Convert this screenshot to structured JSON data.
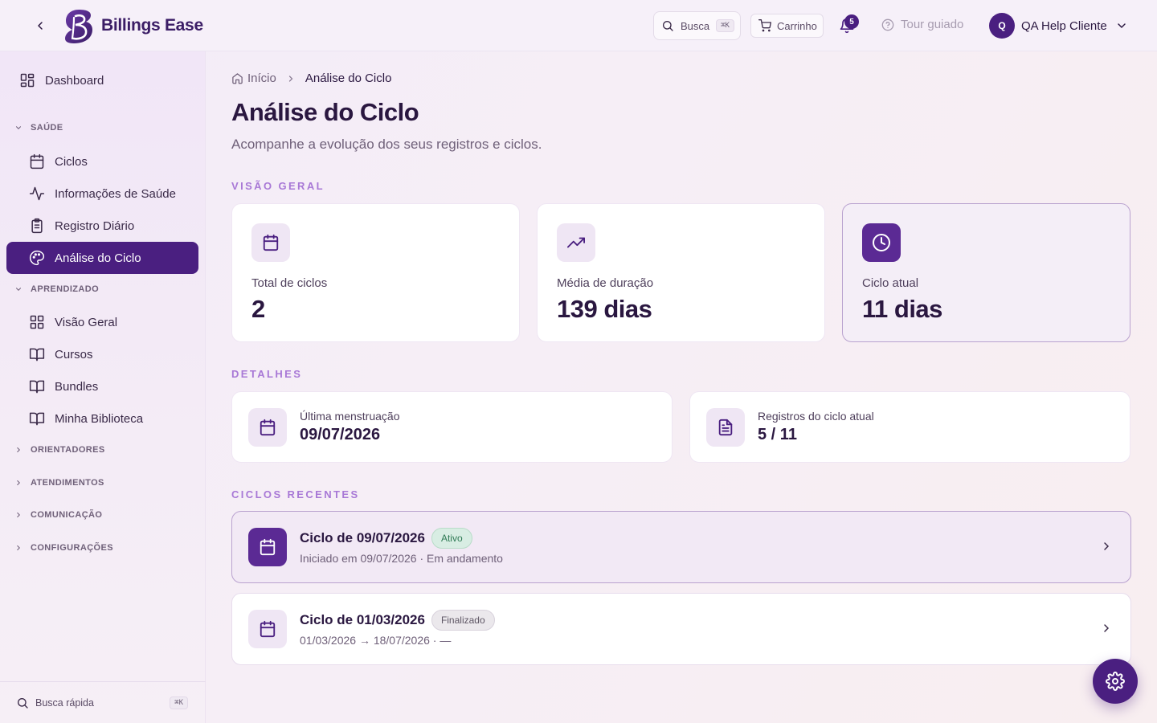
{
  "app": {
    "name": "Billings Ease"
  },
  "header": {
    "search_label": "Busca",
    "search_shortcut": "⌘K",
    "cart_label": "Carrinho",
    "notification_count": "5",
    "tour_label": "Tour guiado",
    "user_initial": "Q",
    "user_name": "QA Help Cliente"
  },
  "sidebar": {
    "dashboard": "Dashboard",
    "sections": {
      "saude": "SAÚDE",
      "aprendizado": "APRENDIZADO",
      "orientadores": "ORIENTADORES",
      "atendimentos": "ATENDIMENTOS",
      "comunicacao": "COMUNICAÇÃO",
      "configuracoes": "CONFIGURAÇÕES"
    },
    "saude_items": [
      "Ciclos",
      "Informações de Saúde",
      "Registro Diário",
      "Análise do Ciclo"
    ],
    "aprendizado_items": [
      "Visão Geral",
      "Cursos",
      "Bundles",
      "Minha Biblioteca"
    ],
    "quick_search": "Busca rápida",
    "quick_search_shortcut": "⌘K"
  },
  "breadcrumb": {
    "home": "Início",
    "current": "Análise do Ciclo"
  },
  "page": {
    "title": "Análise do Ciclo",
    "subtitle": "Acompanhe a evolução dos seus registros e ciclos."
  },
  "overview": {
    "label": "VISÃO GERAL",
    "cards": [
      {
        "label": "Total de ciclos",
        "value": "2",
        "icon": "calendar-icon"
      },
      {
        "label": "Média de duração",
        "value": "139 dias",
        "icon": "trending-up-icon"
      },
      {
        "label": "Ciclo atual",
        "value": "11 dias",
        "icon": "clock-icon"
      }
    ]
  },
  "details": {
    "label": "DETALHES",
    "cards": [
      {
        "label": "Última menstruação",
        "value": "09/07/2026",
        "icon": "calendar-icon"
      },
      {
        "label": "Registros do ciclo atual",
        "value": "5 / 11",
        "icon": "document-icon"
      }
    ]
  },
  "recent": {
    "label": "CICLOS RECENTES",
    "cycles": [
      {
        "title": "Ciclo de 09/07/2026",
        "badge": "Ativo",
        "subtitle": "Iniciado em 09/07/2026 · Em andamento"
      },
      {
        "title": "Ciclo de 01/03/2026",
        "badge": "Finalizado",
        "subtitle": "01/03/2026 → 18/07/2026 · —"
      }
    ]
  },
  "colors": {
    "brand": "#4a1f80",
    "accent_label": "#a878d6",
    "active_badge": "#2f7a55"
  }
}
